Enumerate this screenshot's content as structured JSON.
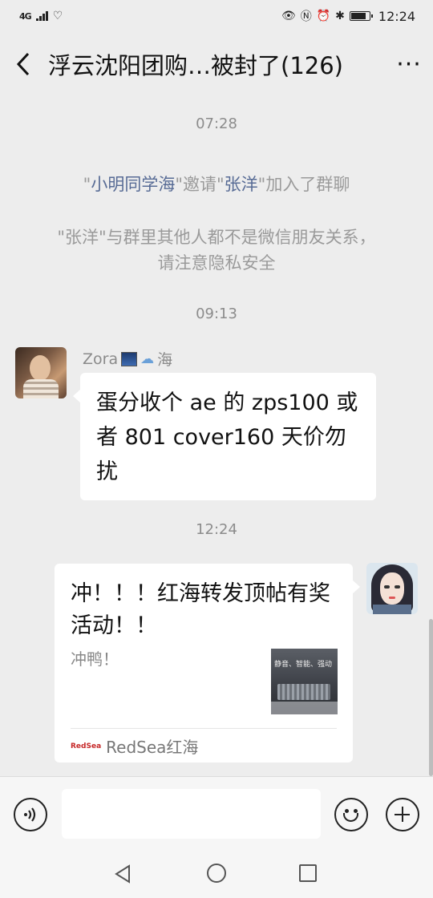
{
  "status_bar": {
    "network": "4G",
    "time": "12:24",
    "battery_level": 0.75
  },
  "header": {
    "title": "浮云沈阳团购…被封了(126)",
    "back_icon": "chevron-left-icon",
    "more_icon": "more-icon"
  },
  "messages": {
    "time_1": "07:28",
    "system_invite": {
      "inviter": "小明同学海",
      "verb": "邀请",
      "invitee": "张洋",
      "suffix": "加入了群聊",
      "q": "\""
    },
    "system_warning_line1": "\"张洋\"与群里其他人都不是微信朋友关系，",
    "system_warning_line2": "请注意隐私安全",
    "time_2": "09:13",
    "zora": {
      "sender_name": "Zora",
      "sender_suffix": "海",
      "text": "蛋分收个 ae 的 zps100 或者 801   cover160    天价勿扰"
    },
    "time_3": "12:24",
    "card": {
      "title": "冲！！！红海转发顶帖有奖活动！！",
      "description": "冲鸭！",
      "thumbnail_text": "静音、智能、强动",
      "source_logo": "RedSea",
      "source": "RedSea红海"
    }
  },
  "input_bar": {
    "voice_icon": "voice-icon",
    "emoji_icon": "emoji-icon",
    "plus_icon": "plus-icon",
    "placeholder": ""
  },
  "nav_bar": {
    "back": "nav-back-icon",
    "home": "nav-home-icon",
    "recents": "nav-recents-icon"
  }
}
